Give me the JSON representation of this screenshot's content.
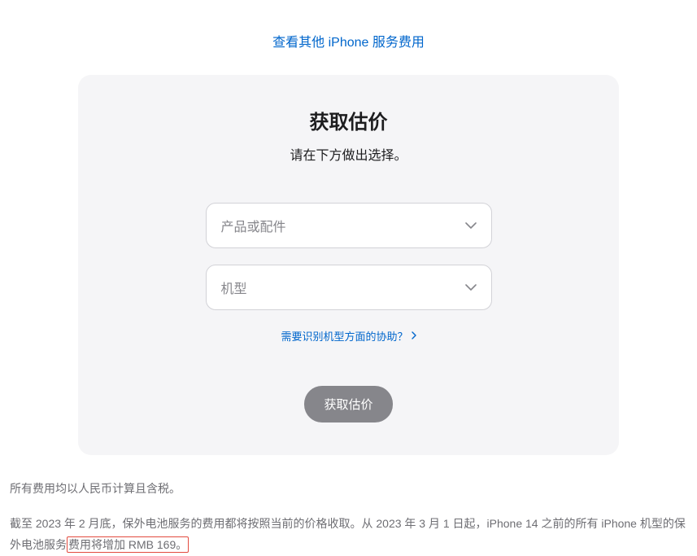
{
  "topLink": {
    "label": "查看其他 iPhone 服务费用"
  },
  "card": {
    "title": "获取估价",
    "subtitle": "请在下方做出选择。",
    "select1": {
      "placeholder": "产品或配件"
    },
    "select2": {
      "placeholder": "机型"
    },
    "helpLink": {
      "label": "需要识别机型方面的协助？"
    },
    "submitButton": {
      "label": "获取估价"
    }
  },
  "footer": {
    "line1": "所有费用均以人民币计算且含税。",
    "note_part1": "截至 2023 年 2 月底，保外电池服务的费用都将按照当前的价格收取。从 2023 年 3 月 1 日起，iPhone 14 之前的所有 iPhone 机型的保外电池服",
    "note_part2_prefix": "务",
    "note_highlight": "费用将增加 RMB 169。"
  }
}
